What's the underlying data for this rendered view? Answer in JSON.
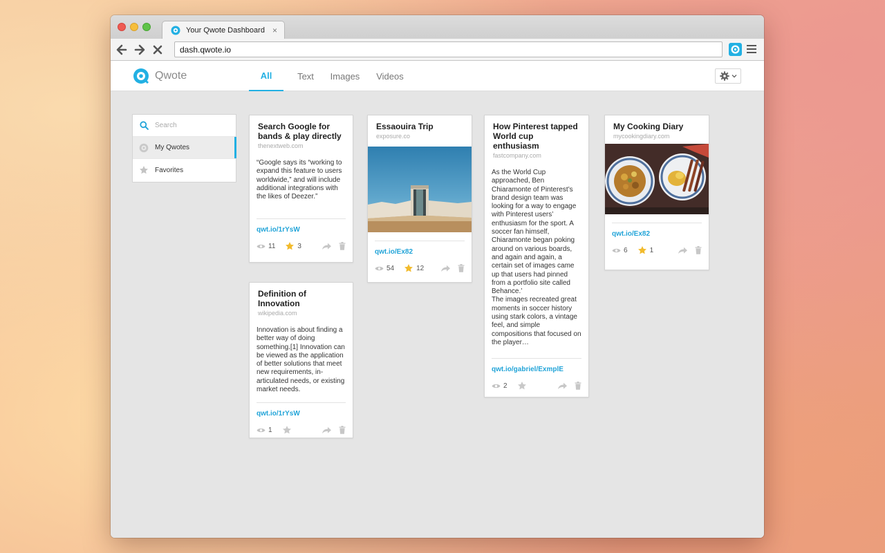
{
  "browser": {
    "tab_title": "Your Qwote Dashboard",
    "tab_close": "×",
    "url": "dash.qwote.io"
  },
  "app": {
    "brand": "Qwote",
    "accent": "#22b0e3",
    "nav_tabs": [
      {
        "label": "All",
        "active": true
      },
      {
        "label": "Text",
        "active": false
      },
      {
        "label": "Images",
        "active": false
      },
      {
        "label": "Videos",
        "active": false
      }
    ]
  },
  "sidebar": {
    "search_placeholder": "Search",
    "items": [
      {
        "label": "My Qwotes",
        "icon": "qwote-circle-icon",
        "active": true
      },
      {
        "label": "Favorites",
        "icon": "star-icon",
        "active": false
      }
    ]
  },
  "cards": [
    {
      "title": "Search Google for bands & play directly",
      "source": "thenextweb.com",
      "text": "“Google says its “working to expand this feature to users worldwide,” and will include additional integrations with the likes of Deezer.”",
      "link": "qwt.io/1rYsW",
      "views": "11",
      "stars": "3"
    },
    {
      "title": "Essaouira Trip",
      "source": "exposure.co",
      "image": "desert-wall-doorway-photo",
      "link": "qwt.io/Ex82",
      "views": "54",
      "stars": "12"
    },
    {
      "title": "How Pinterest tapped World cup enthusiasm",
      "source": "fastcompany.com",
      "text": "As the World Cup approached, Ben Chiaramonte of Pinterest’s brand design team was looking for a way to engage with Pinterest users’ enthusiasm for the sport. A soccer fan himself, Chiaramonte began poking around on various boards, and again and again, a certain set of images came up that users had pinned from a portfolio site called Behance.’",
      "text2": "The images recreated great moments in soccer history using stark colors, a vintage feel, and simple compositions that focused on the player…",
      "link": "qwt.io/gabriel/ExmplE",
      "views": "2",
      "stars": ""
    },
    {
      "title": "My Cooking Diary",
      "source": "mycookingdiary.com",
      "image": "food-plates-photo",
      "link": "qwt.io/Ex82",
      "views": "6",
      "stars": "1"
    },
    {
      "title": "Definition of Innovation",
      "source": "wikipedia.com",
      "text": "Innovation is about finding a better way of doing something.[1] Innovation can be viewed as the application of better solutions that meet new requirements, in-articulated needs, or existing market needs.",
      "link": "qwt.io/1rYsW",
      "views": "1",
      "stars": ""
    }
  ]
}
